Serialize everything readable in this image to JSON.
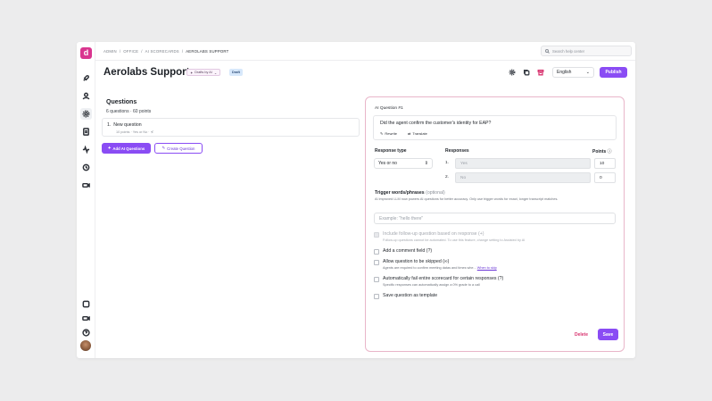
{
  "sidebar": {
    "logo": "d",
    "icons": [
      "rocket-icon",
      "user-icon",
      "gear-icon",
      "scorecard-icon",
      "activity-icon",
      "history-icon",
      "video-icon"
    ],
    "bottom_icons": [
      "app-logo-icon",
      "camera-icon",
      "help-icon"
    ]
  },
  "breadcrumb": [
    "ADMIN",
    "/",
    "OFFICE",
    "/",
    "AI SCORECARDS",
    "/",
    "AEROLABS SUPPORT"
  ],
  "search": {
    "placeholder": "Search help center"
  },
  "header": {
    "title": "Aerolabs Support",
    "drafted_by": "Drafts by AI",
    "status": "Draft",
    "language": "English",
    "publish": "Publish"
  },
  "questions": {
    "heading": "Questions",
    "meta": "6 questions  ·  60 points",
    "items": [
      {
        "number": "1.",
        "title": "New question",
        "sub": "10 points  ·  Yes or No  ·  ⊀"
      }
    ],
    "add_ai": "Add AI Questions",
    "create": "Create Question"
  },
  "editor": {
    "header": "AI Question #1",
    "question_text": "Did the agent confirm the customer's identity for EAP?",
    "rewrite": "Rewrite",
    "translate": "Translate",
    "response_type_label": "Response type",
    "response_type_value": "Yes or no",
    "responses_label": "Responses",
    "points_label": "Points",
    "responses": [
      {
        "num": "1.",
        "value": "Yes",
        "points": "10"
      },
      {
        "num": "2.",
        "value": "No",
        "points": "0"
      }
    ],
    "trigger_title": "Trigger words/phrases",
    "trigger_optional": "(optional)",
    "trigger_desc": "AI improved LLM now powers AI questions for better accuracy. Only use trigger words for exact, longer transcript matches.",
    "trigger_placeholder": "Example: \"hello there\"",
    "options": [
      {
        "label": "Include follow-up question based on response (+)",
        "sub": "Follow-up questions cannot be automated. To use this feature, change setting to Assisted by AI",
        "disabled": true
      },
      {
        "label": "Add a comment field (?)",
        "sub": "",
        "disabled": false
      },
      {
        "label": "Allow question to be skipped (∞)",
        "sub": "Agents are required to confirm meeting datas and times whe...",
        "link": "When to skip",
        "disabled": false
      },
      {
        "label": "Automatically fail entire scorecard for certain responses (?)",
        "sub": "Specific responses can automatically assign a 0% grade to a call",
        "disabled": false
      },
      {
        "label": "Save question as template",
        "sub": "",
        "disabled": false
      }
    ],
    "delete": "Delete",
    "save": "Save"
  },
  "colors": {
    "accent": "#8a4cf4",
    "brand": "#d9358f",
    "danger": "#d8336f"
  }
}
